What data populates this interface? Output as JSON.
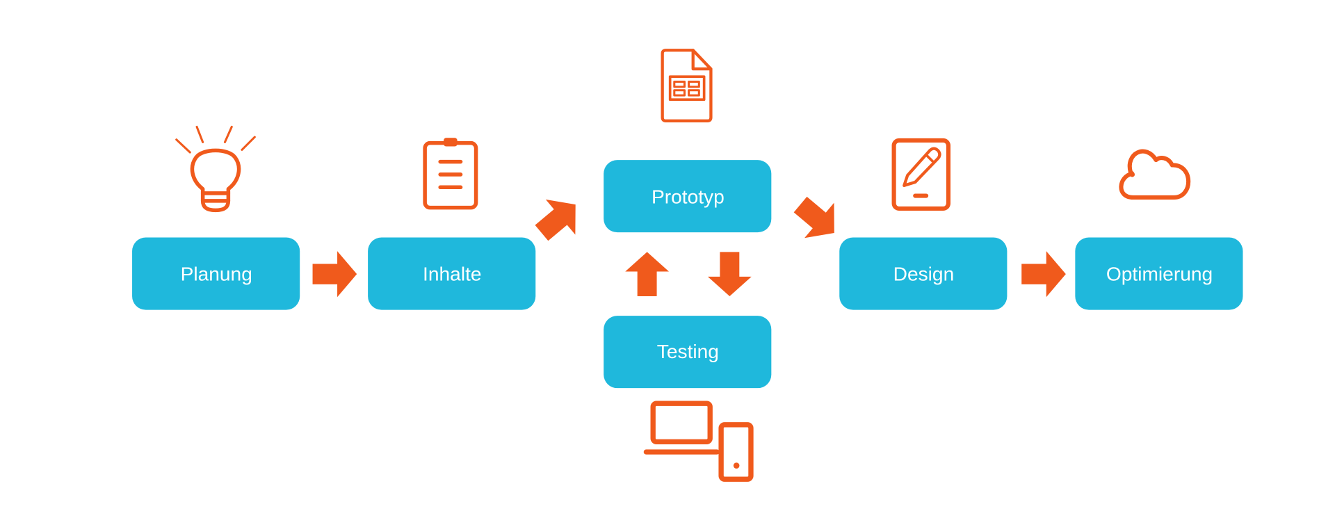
{
  "steps": {
    "planung": "Planung",
    "inhalte": "Inhalte",
    "prototyp": "Prototyp",
    "testing": "Testing",
    "design": "Design",
    "optimierung": "Optimierung"
  },
  "colors": {
    "box": "#1fb8dc",
    "accent": "#f05a1c",
    "text": "#ffffff"
  },
  "icons": {
    "planung": "lightbulb-icon",
    "inhalte": "clipboard-icon",
    "prototyp": "wireframe-document-icon",
    "testing": "laptop-phone-icon",
    "design": "tablet-pen-icon",
    "optimierung": "cloud-icon"
  }
}
